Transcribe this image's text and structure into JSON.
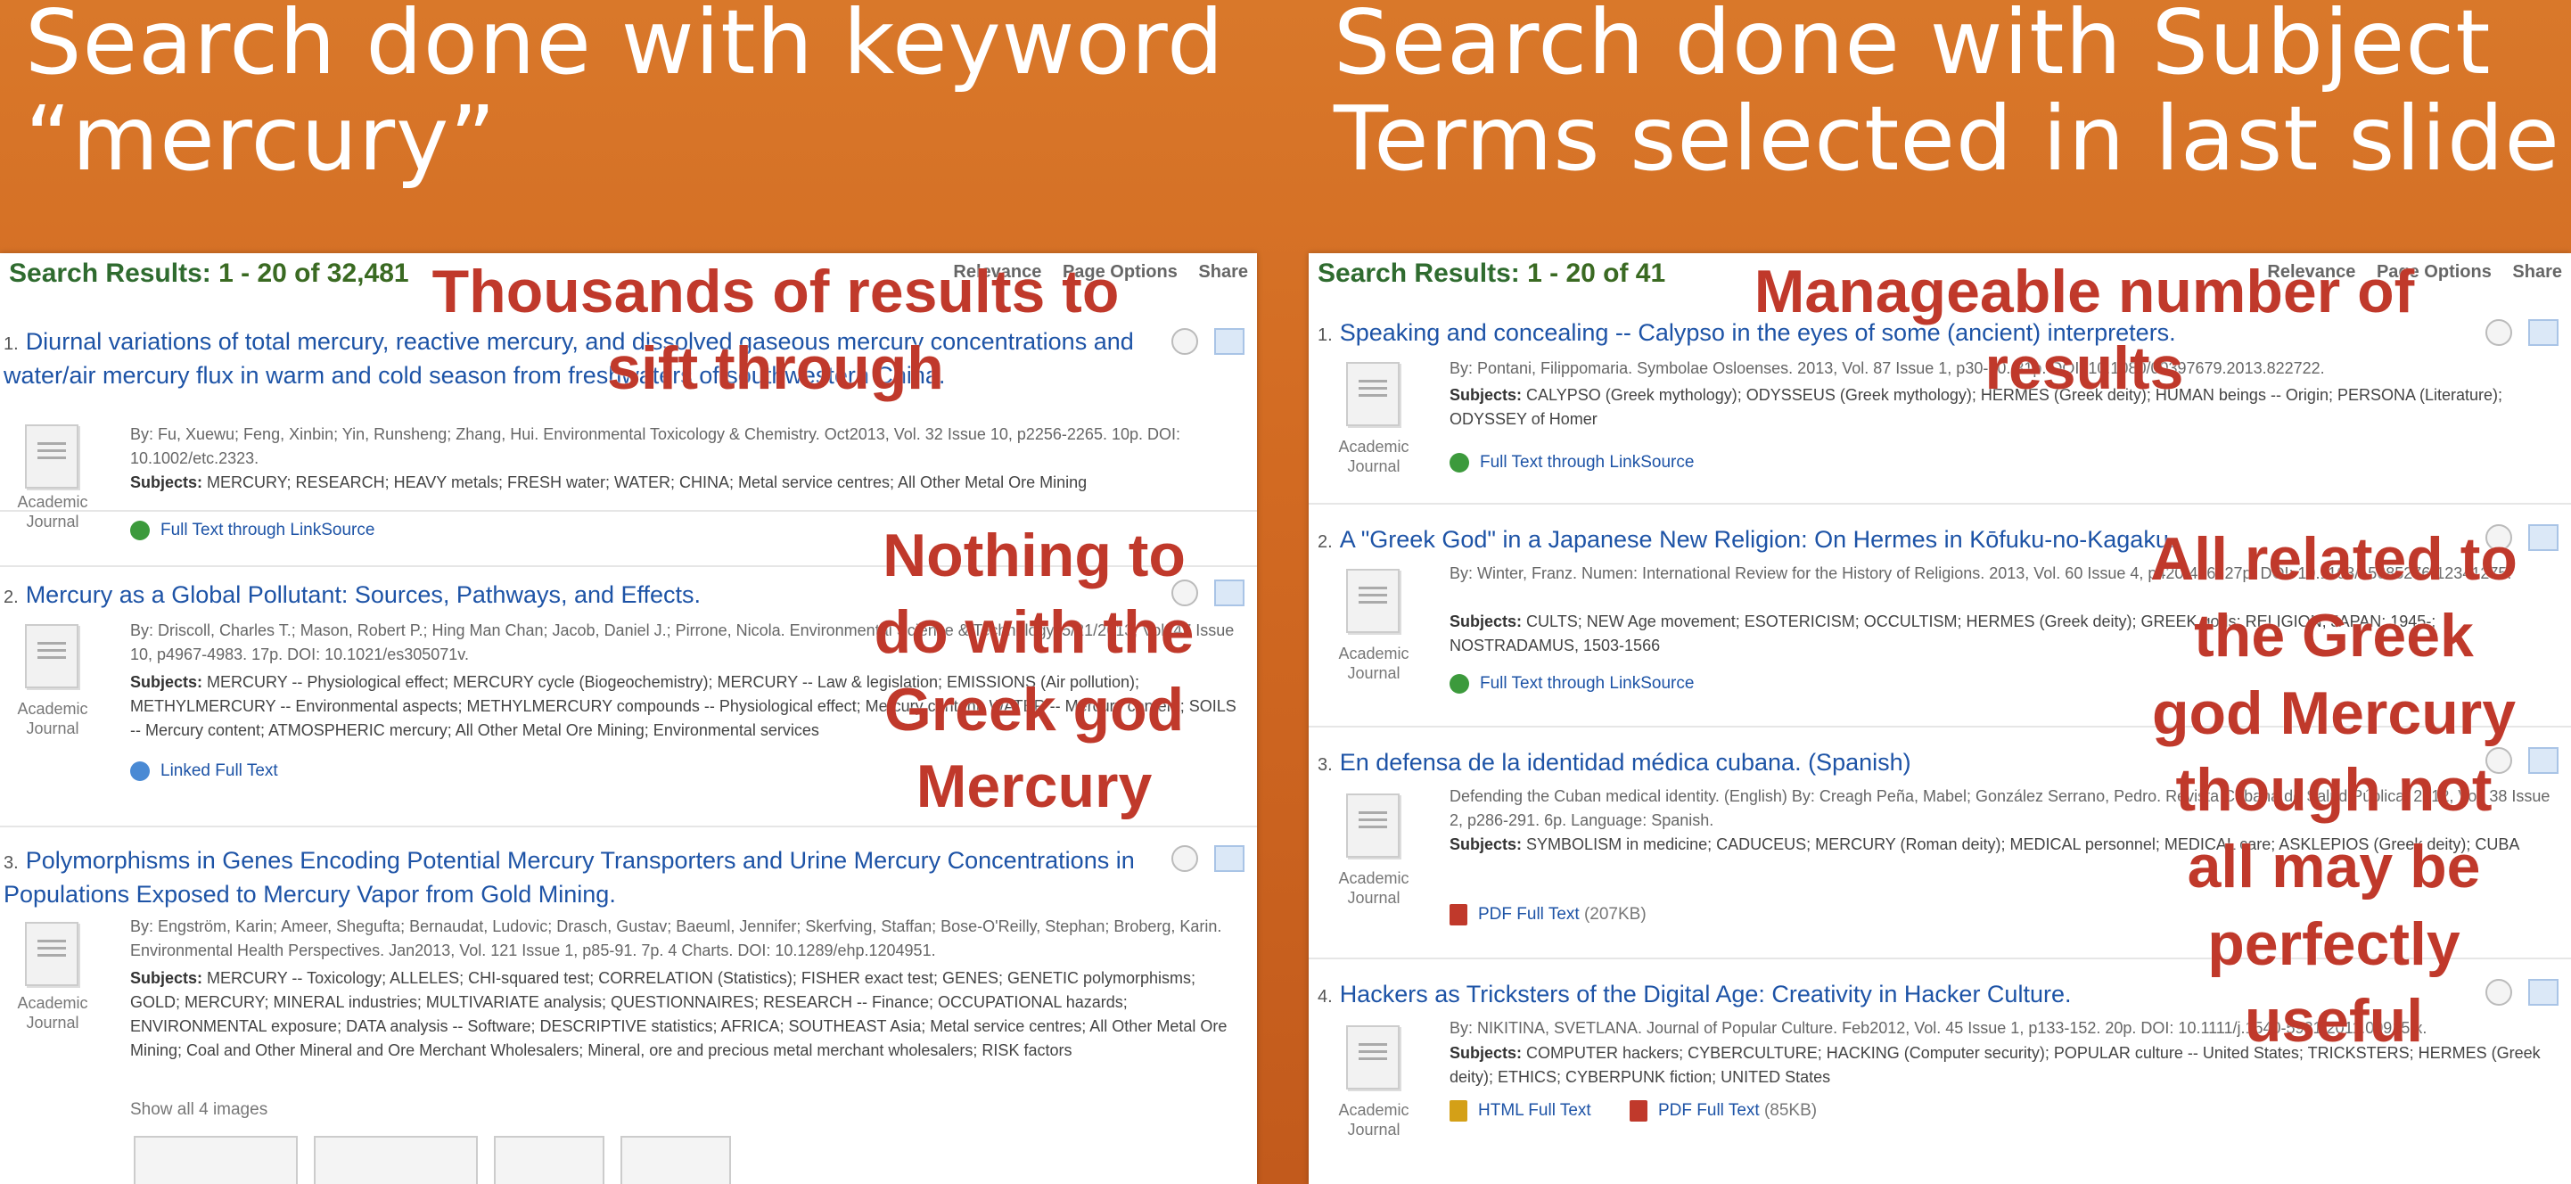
{
  "slide": {
    "left_title": "Search done with keyword\n“mercury”",
    "right_title": "Search done with Subject\nTerms selected in last slide"
  },
  "left": {
    "header_label": "Search Results:",
    "header_count": "1 - 20 of 32,481",
    "tools": [
      "Relevance",
      "Page Options",
      "Share"
    ],
    "results": [
      {
        "num": "1.",
        "title": "Diurnal variations of total mercury, reactive mercury, and dissolved gaseous mercury concentrations and water/air mercury flux in warm and cold season from freshwaters of southwestern China.",
        "meta": "By: Fu, Xuewu; Feng, Xinbin; Yin, Runsheng; Zhang, Hui. Environmental Toxicology & Chemistry. Oct2013, Vol. 32 Issue 10, p2256-2265. 10p. DOI: 10.1002/etc.2323.",
        "subjects_label": "Subjects:",
        "subjects": "MERCURY; RESEARCH; HEAVY metals; FRESH water; WATER; CHINA; Metal service centres; All Other Metal Ore Mining",
        "doc_type": "Academic Journal",
        "link": "Full Text through LinkSource"
      },
      {
        "num": "2.",
        "title": "Mercury as a Global Pollutant: Sources, Pathways, and Effects.",
        "meta": "By: Driscoll, Charles T.; Mason, Robert P.; Hing Man Chan; Jacob, Daniel J.; Pirrone, Nicola. Environmental Science & Technology. 5/21/2013, Vol. 47 Issue 10, p4967-4983. 17p. DOI: 10.1021/es305071v.",
        "subjects_label": "Subjects:",
        "subjects": "MERCURY -- Physiological effect; MERCURY cycle (Biogeochemistry); MERCURY -- Law & legislation; EMISSIONS (Air pollution); METHYLMERCURY -- Environmental aspects; METHYLMERCURY compounds -- Physiological effect; Mercury content; WATER -- Mercury content; SOILS -- Mercury content; ATMOSPHERIC mercury; All Other Metal Ore Mining; Environmental services",
        "doc_type": "Academic Journal",
        "link": "Linked Full Text"
      },
      {
        "num": "3.",
        "title": "Polymorphisms in Genes Encoding Potential Mercury Transporters and Urine Mercury Concentrations in Populations Exposed to Mercury Vapor from Gold Mining.",
        "meta": "By: Engström, Karin; Ameer, Shegufta; Bernaudat, Ludovic; Drasch, Gustav; Baeuml, Jennifer; Skerfving, Staffan; Bose-O'Reilly, Stephan; Broberg, Karin. Environmental Health Perspectives. Jan2013, Vol. 121 Issue 1, p85-91. 7p. 4 Charts. DOI: 10.1289/ehp.1204951.",
        "subjects_label": "Subjects:",
        "subjects": "MERCURY -- Toxicology; ALLELES; CHI-squared test; CORRELATION (Statistics); FISHER exact test; GENES; GENETIC polymorphisms; GOLD; MERCURY; MINERAL industries; MULTIVARIATE analysis; QUESTIONNAIRES; RESEARCH -- Finance; OCCUPATIONAL hazards; ENVIRONMENTAL exposure; DATA analysis -- Software; DESCRIPTIVE statistics; AFRICA; SOUTHEAST Asia; Metal service centres; All Other Metal Ore Mining; Coal and Other Mineral and Ore Merchant Wholesalers; Mineral, ore and precious metal merchant wholesalers; RISK factors",
        "doc_type": "Academic Journal",
        "show_all": "Show all 4 images"
      }
    ],
    "overlay_top": "Thousands of results to\nsift through",
    "overlay_mid": "Nothing to\ndo with the\nGreek god\nMercury"
  },
  "right": {
    "header_label": "Search Results:",
    "header_count": "1 - 20 of 41",
    "tools": [
      "Relevance",
      "Page Options",
      "Share"
    ],
    "results": [
      {
        "num": "1.",
        "title": "Speaking and concealing -- Calypso in the eyes of some (ancient) interpreters.",
        "meta": "By: Pontani, Filippomaria. Symbolae Osloenses. 2013, Vol. 87 Issue 1, p30-60. 31p. DOI: 10.1080/00397679.2013.822722.",
        "subjects_label": "Subjects:",
        "subjects": "CALYPSO (Greek mythology); ODYSSEUS (Greek mythology); HERMES (Greek deity); HUMAN beings -- Origin; PERSONA (Literature); ODYSSEY of Homer",
        "doc_type": "Academic Journal",
        "link": "Full Text through LinkSource"
      },
      {
        "num": "2.",
        "title": "A \"Greek God\" in a Japanese New Religion: On Hermes in Kōfuku-no-Kagaku.",
        "meta": "By: Winter, Franz. Numen: International Review for the History of Religions. 2013, Vol. 60 Issue 4, p420-446. 27p. DOI: 10.1163/15685276-12341275.",
        "subjects_label": "Subjects:",
        "subjects": "CULTS; NEW Age movement; ESOTERICISM; OCCULTISM; HERMES (Greek deity); GREEK gods; RELIGION; JAPAN; 1945-; NOSTRADAMUS, 1503-1566",
        "doc_type": "Academic Journal",
        "link": "Full Text through LinkSource"
      },
      {
        "num": "3.",
        "title": "En defensa de la identidad médica cubana. (Spanish)",
        "meta": "Defending the Cuban medical identity. (English) By: Creagh Peña, Mabel; González Serrano, Pedro. Revista Cubana de Salud Pública. 2012, Vol. 38 Issue 2, p286-291. 6p. Language: Spanish.",
        "subjects_label": "Subjects:",
        "subjects": "SYMBOLISM in medicine; CADUCEUS; MERCURY (Roman deity); MEDICAL personnel; MEDICAL care; ASKLEPIOS (Greek deity); CUBA",
        "doc_type": "Academic Journal",
        "link": "PDF Full Text",
        "link_size": "(207KB)"
      },
      {
        "num": "4.",
        "title": "Hackers as Tricksters of the Digital Age: Creativity in Hacker Culture.",
        "meta": "By: NIKITINA, SVETLANA. Journal of Popular Culture. Feb2012, Vol. 45 Issue 1, p133-152. 20p. DOI: 10.1111/j.1540-5931.2011.00915.x.",
        "subjects_label": "Subjects:",
        "subjects": "COMPUTER hackers; CYBERCULTURE; HACKING (Computer security); POPULAR culture -- United States; TRICKSTERS; HERMES (Greek deity); ETHICS; CYBERPUNK fiction; UNITED States",
        "doc_type": "Academic Journal",
        "link": "HTML Full Text",
        "link2": "PDF Full Text",
        "link2_size": "(85KB)"
      }
    ],
    "overlay_top": "Manageable number of\nresults",
    "overlay_mid": "All related to\nthe Greek\ngod Mercury\nthough not\nall may be\nperfectly\nuseful"
  }
}
